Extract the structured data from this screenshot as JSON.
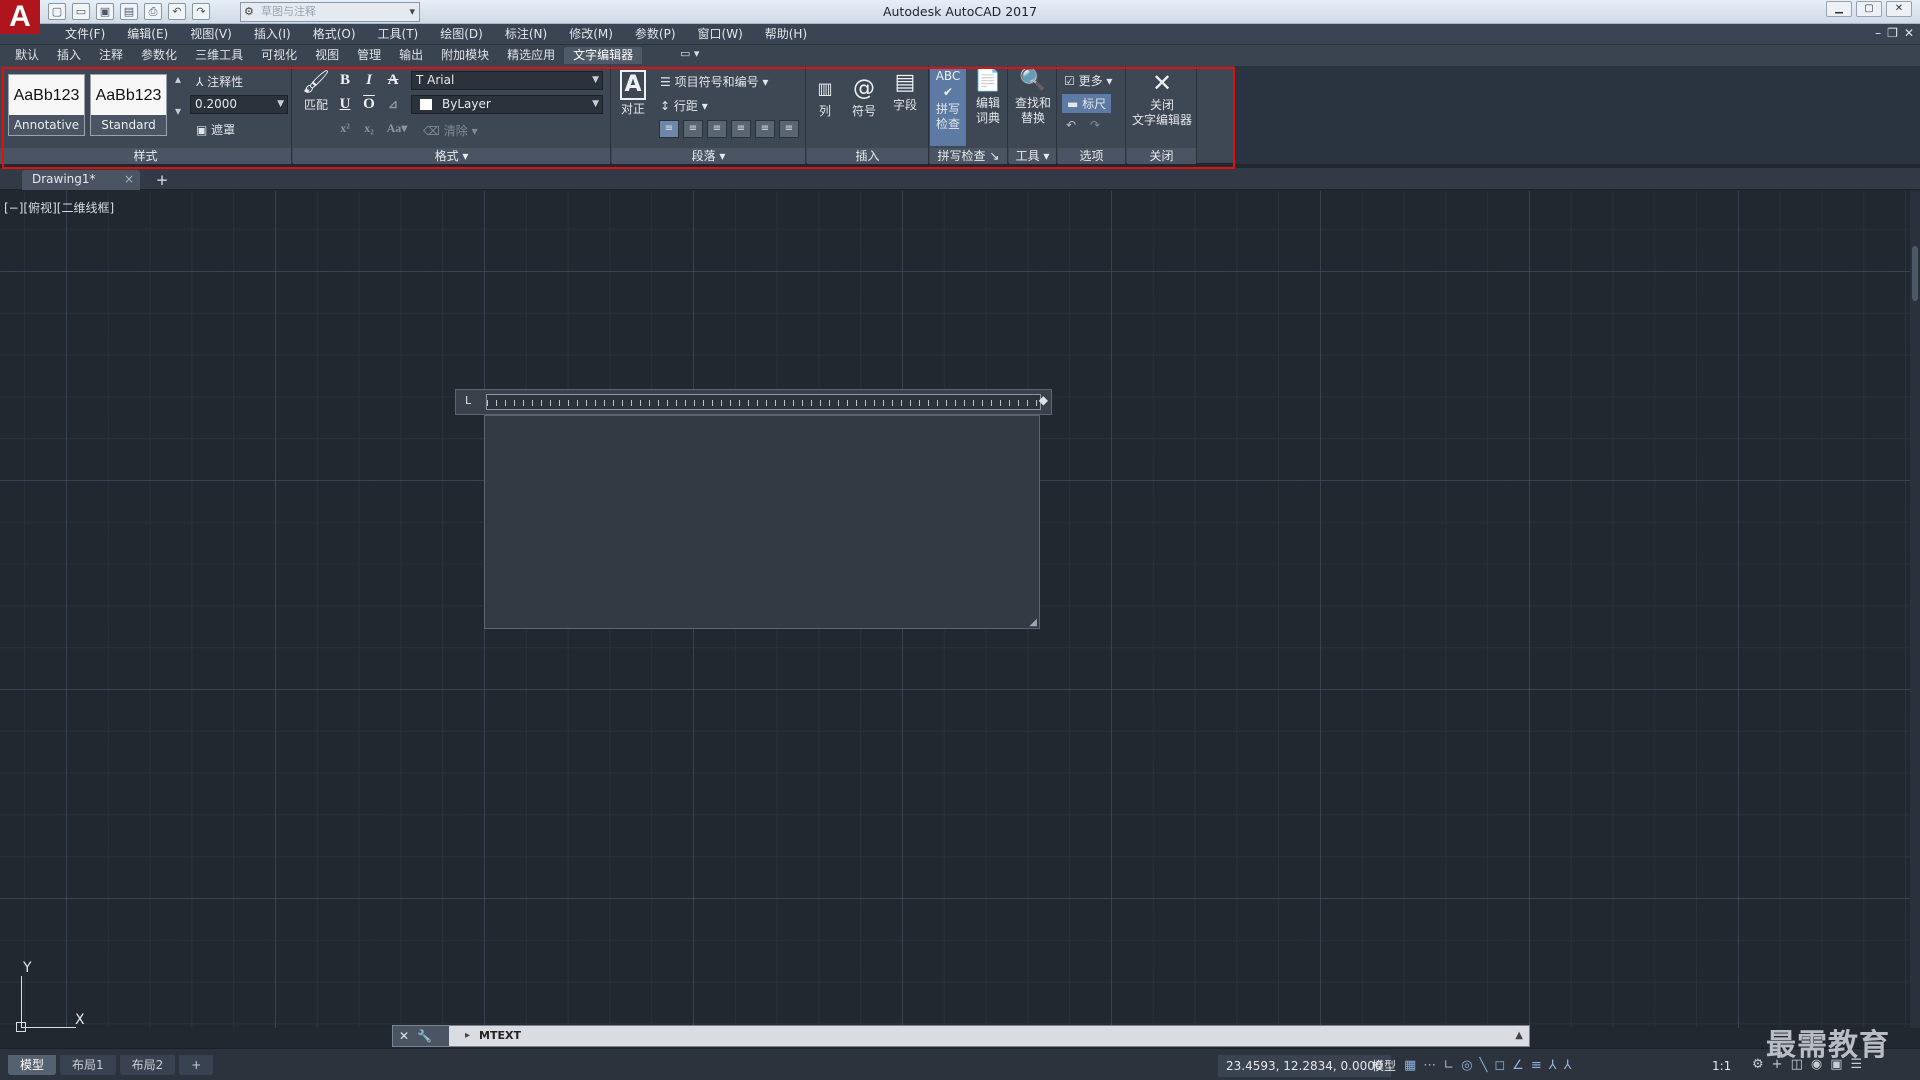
{
  "app": {
    "logo": "A",
    "title": "Autodesk AutoCAD 2017",
    "workspace": "草图与注释"
  },
  "qat_icons": [
    "new-icon",
    "open-icon",
    "save-icon",
    "saveas-icon",
    "print-icon",
    "undo-icon",
    "redo-icon"
  ],
  "menubar": [
    "文件(F)",
    "编辑(E)",
    "视图(V)",
    "插入(I)",
    "格式(O)",
    "工具(T)",
    "绘图(D)",
    "标注(N)",
    "修改(M)",
    "参数(P)",
    "窗口(W)",
    "帮助(H)"
  ],
  "ribbon_tabs": [
    "默认",
    "插入",
    "注释",
    "参数化",
    "三维工具",
    "可视化",
    "视图",
    "管理",
    "输出",
    "附加模块",
    "精选应用",
    "文字编辑器"
  ],
  "ribbon_tabs_active_index": 11,
  "ribbon": {
    "style": {
      "sample": "AaBb123",
      "style1": "Annotative",
      "style2": "Standard",
      "annotative": "注释性",
      "height": "0.2000",
      "mask": "遮罩",
      "label": "样式"
    },
    "format": {
      "match": "匹配",
      "bold": "B",
      "italic": "I",
      "strike": "A",
      "underline": "U",
      "overline": "O",
      "font": "Arial",
      "color": "ByLayer",
      "clear": "清除",
      "label": "格式"
    },
    "paragraph": {
      "justify": "对正",
      "bullets": "项目符号和编号",
      "linespacing": "行距",
      "label": "段落"
    },
    "insert": {
      "columns": "列",
      "symbol": "符号",
      "field": "字段",
      "label": "插入"
    },
    "spell": {
      "check_line1": "拼写",
      "check_line2": "检查",
      "dict_line1": "编辑",
      "dict_line2": "词典",
      "label": "拼写检查"
    },
    "tools": {
      "find_line1": "查找和",
      "find_line2": "替换",
      "label": "工具"
    },
    "options": {
      "more": "更多",
      "ruler": "标尺",
      "label": "选项"
    },
    "close": {
      "line1": "关闭",
      "line2": "文字编辑器",
      "label": "关闭"
    }
  },
  "doc_tab": {
    "name": "Drawing1*",
    "close": "×",
    "add": "+"
  },
  "viewport_label": "[−][俯视][二维线框]",
  "ucs": {
    "x": "X",
    "y": "Y"
  },
  "command": {
    "text": "MTEXT"
  },
  "status": {
    "layout_tabs": [
      "模型",
      "布局1",
      "布局2"
    ],
    "add_layout": "+",
    "coords": "23.4593, 12.2834, 0.0000",
    "model": "模型",
    "scale": "1:1"
  },
  "watermark": "最需教育"
}
